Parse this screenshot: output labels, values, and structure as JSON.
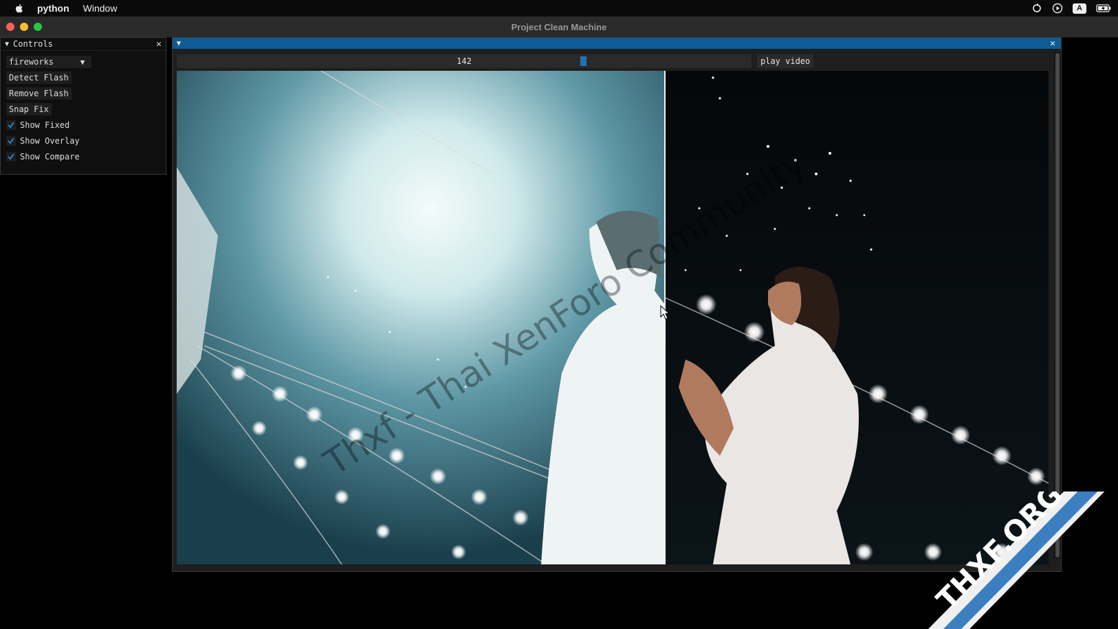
{
  "menubar": {
    "app_name": "python",
    "menu_window": "Window",
    "input_indicator": "A"
  },
  "window": {
    "title": "Project Clean Machine"
  },
  "controls": {
    "title": "Controls",
    "preset_value": "fireworks",
    "buttons": [
      "Detect Flash",
      "Remove Flash",
      "Snap Fix"
    ],
    "checkboxes": [
      {
        "label": "Show Fixed",
        "checked": true
      },
      {
        "label": "Show Overlay",
        "checked": true
      },
      {
        "label": "Show Compare",
        "checked": true
      }
    ]
  },
  "viewer": {
    "frame_value": "142",
    "frame_fraction": 0.71,
    "play_label": "play video",
    "compare_split_fraction": 0.56
  },
  "watermark": {
    "text": "Thxf - Thai XenForo Community",
    "badge": "THXF.ORG"
  },
  "colors": {
    "accent": "#1f74b8",
    "header_blue": "#0f5b95"
  }
}
